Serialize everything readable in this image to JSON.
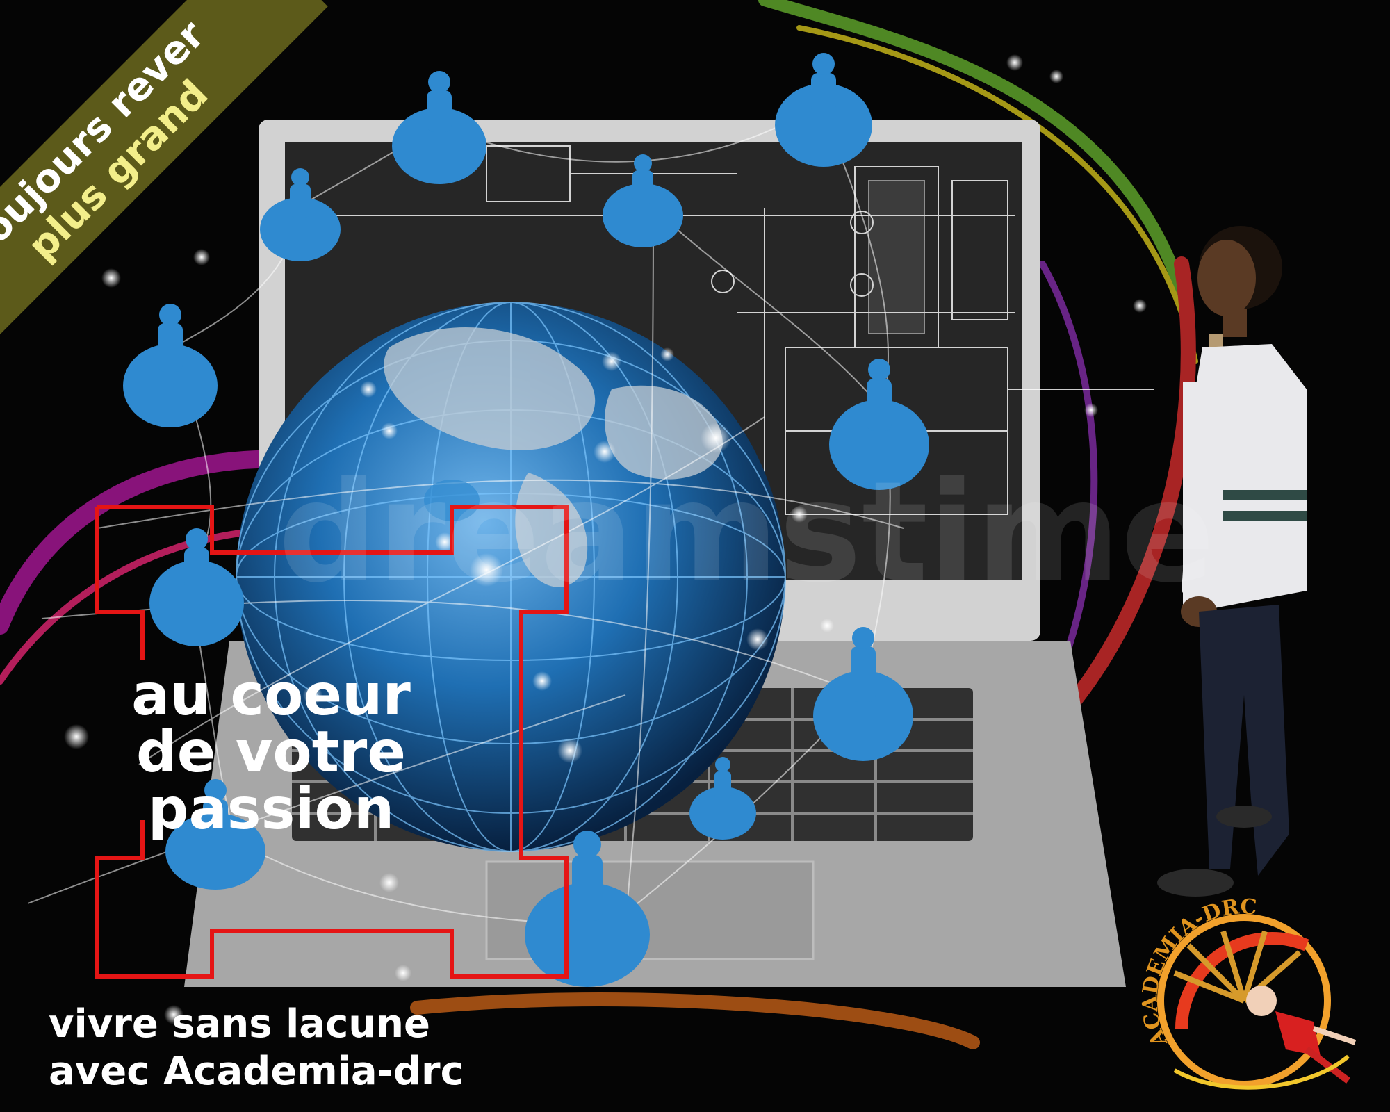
{
  "banner": {
    "line1": "toujours rever",
    "line2": "plus grand"
  },
  "heading": {
    "line1": "au coeur",
    "line2": "de votre",
    "line3": "passion"
  },
  "tagline": {
    "line1": "vivre sans lacune",
    "line2": "avec Academia-drc"
  },
  "logo": {
    "text": "ACADEMIA-DRC"
  },
  "watermark": "dreamstime",
  "colors": {
    "frame": "#e51515",
    "banner": "#5c5a1a",
    "node": "#2f8ad0",
    "globe": "#1f6fb3"
  }
}
